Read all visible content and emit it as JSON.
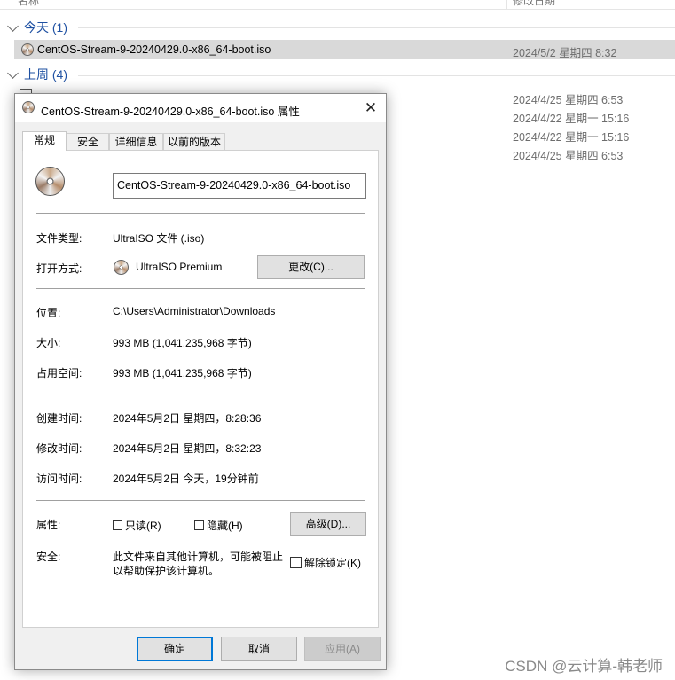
{
  "explorer": {
    "columns": {
      "name": "名称",
      "date": "修改日期"
    },
    "groups": [
      {
        "label": "今天 (1)"
      },
      {
        "label": "上周 (4)"
      }
    ],
    "selected_file": {
      "name": "CentOS-Stream-9-20240429.0-x86_64-boot.iso",
      "date": "2024/5/2 星期四 8:32"
    },
    "last_week_dates": [
      "2024/4/25 星期四 6:53",
      "2024/4/22 星期一 15:16",
      "2024/4/22 星期一 15:16",
      "2024/4/25 星期四 6:53"
    ]
  },
  "dialog": {
    "title": "CentOS-Stream-9-20240429.0-x86_64-boot.iso 属性",
    "close_icon": "close-icon",
    "tabs": [
      {
        "label": "常规",
        "active": true
      },
      {
        "label": "安全"
      },
      {
        "label": "详细信息"
      },
      {
        "label": "以前的版本"
      }
    ],
    "file_name_value": "CentOS-Stream-9-20240429.0-x86_64-boot.iso",
    "file_type": {
      "label": "文件类型:",
      "value": "UltraISO 文件 (.iso)"
    },
    "open_with": {
      "label": "打开方式:",
      "value": "UltraISO Premium",
      "change_button": "更改(C)..."
    },
    "location": {
      "label": "位置:",
      "value": "C:\\Users\\Administrator\\Downloads"
    },
    "size": {
      "label": "大小:",
      "value": "993 MB (1,041,235,968 字节)"
    },
    "size_on_disk": {
      "label": "占用空间:",
      "value": "993 MB (1,041,235,968 字节)"
    },
    "created": {
      "label": "创建时间:",
      "value": "2024年5月2日 星期四，8:28:36"
    },
    "modified": {
      "label": "修改时间:",
      "value": "2024年5月2日 星期四，8:32:23"
    },
    "accessed": {
      "label": "访问时间:",
      "value": "2024年5月2日 今天，19分钟前"
    },
    "attributes": {
      "label": "属性:",
      "readonly": "只读(R)",
      "hidden": "隐藏(H)",
      "advanced_button": "高级(D)..."
    },
    "security": {
      "label": "安全:",
      "text_line1": "此文件来自其他计算机，可能被阻止",
      "text_line2": "以帮助保护该计算机。",
      "unblock": "解除锁定(K)"
    },
    "buttons": {
      "ok": "确定",
      "cancel": "取消",
      "apply": "应用(A)"
    }
  },
  "watermark": "CSDN @云计算-韩老师",
  "colors": {
    "accent": "#0078d7",
    "group_header": "#1e50a2",
    "selection": "#d9d9d9"
  }
}
